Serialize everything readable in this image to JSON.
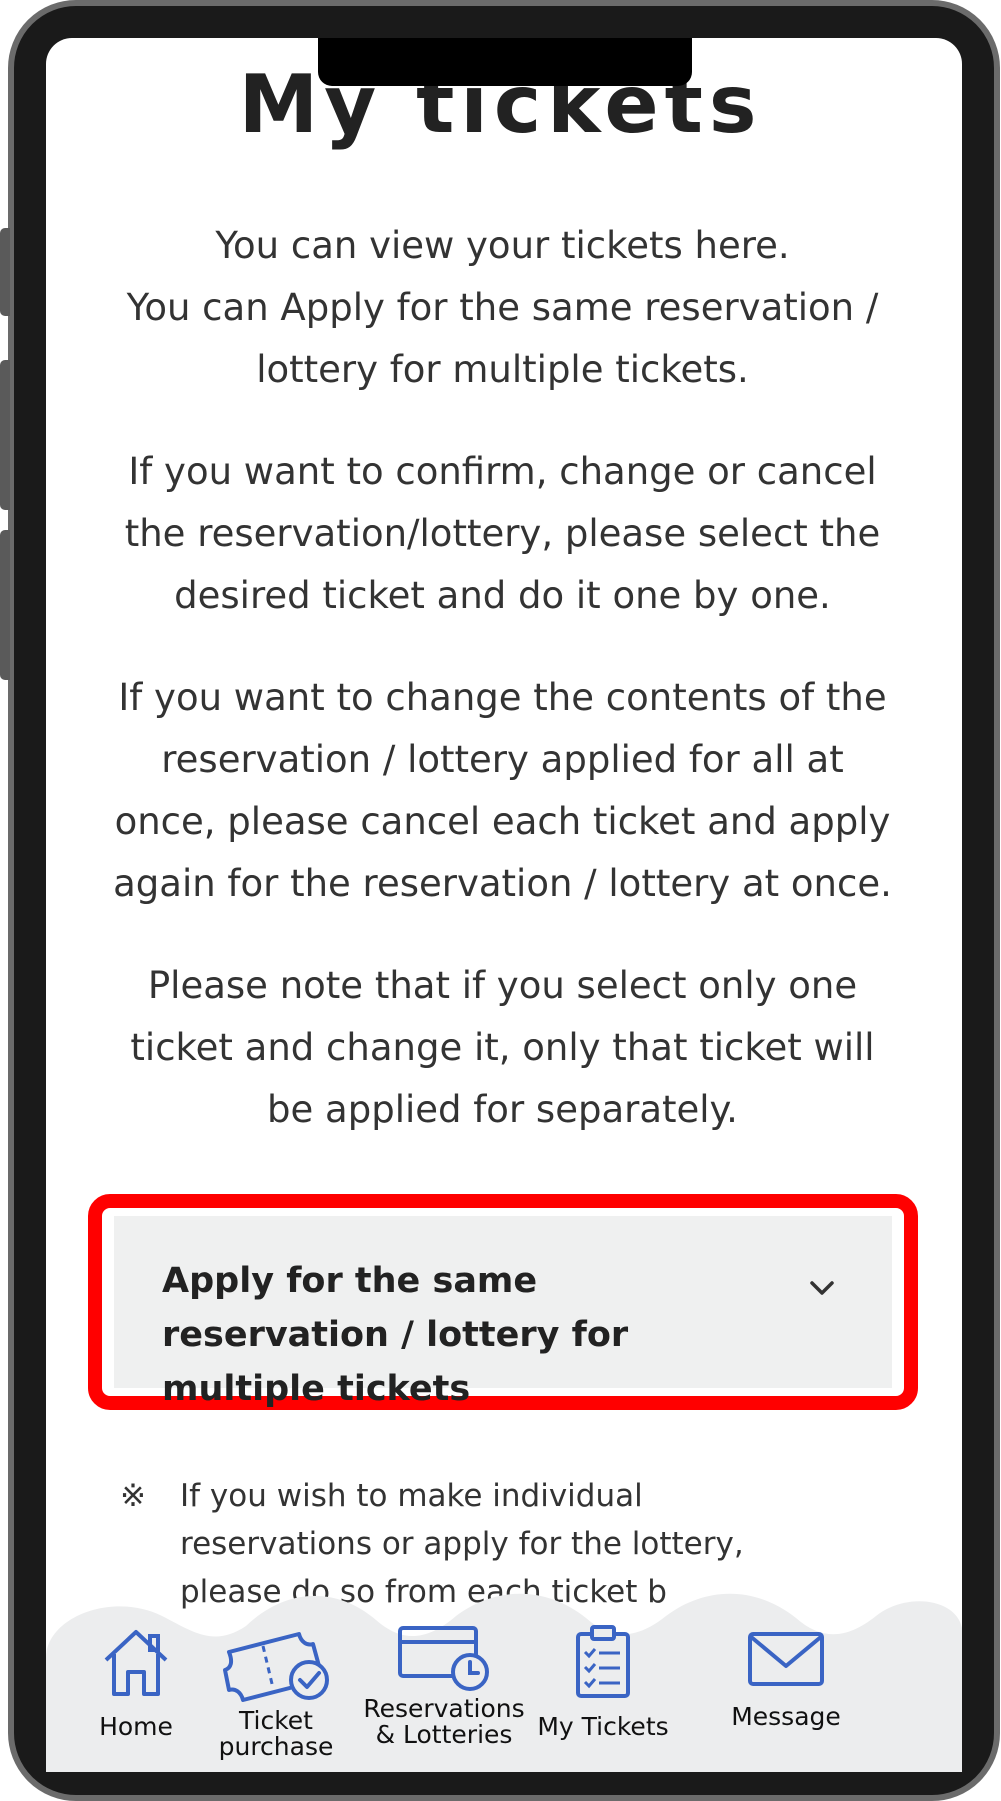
{
  "page": {
    "title": "My tickets",
    "paragraphs": [
      "You can view your tickets here.\nYou can Apply for the same reservation / lottery for multiple tickets.",
      "If you want to confirm, change or cancel the reservation/lottery, please select the desired ticket and do it one by one.",
      "If you want to change the contents of the reservation / lottery applied for all at once, please cancel each ticket and apply again for the reservation / lottery at once.",
      "Please note that if you select only one ticket and change it, only that ticket will be applied for separately."
    ]
  },
  "accordion": {
    "label": "Apply for the same reservation / lottery for multiple tickets",
    "highlight_color": "#ff0000"
  },
  "note": {
    "mark": "※",
    "text": "If you wish to make individual reservations or apply for the lottery, please do so from each ticket b"
  },
  "nav": {
    "items": [
      {
        "label": "Home",
        "icon": "home-icon"
      },
      {
        "label": "Ticket purchase",
        "icon": "ticket-purchase-icon"
      },
      {
        "label": "Reservations & Lotteries",
        "icon": "calendar-clock-icon"
      },
      {
        "label": "My Tickets",
        "icon": "clipboard-list-icon"
      },
      {
        "label": "Message",
        "icon": "envelope-icon"
      }
    ],
    "icon_color": "#3a64c4"
  }
}
